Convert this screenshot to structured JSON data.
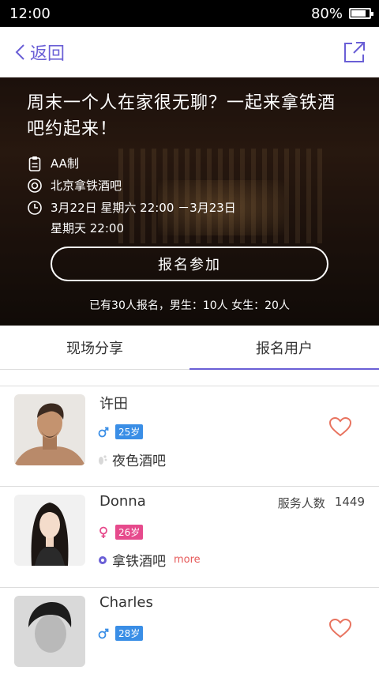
{
  "status_bar": {
    "time": "12:00",
    "battery": "80%",
    "battery_level": 0.8
  },
  "navbar": {
    "back_label": "返回"
  },
  "event": {
    "title": "周末一个人在家很无聊？一起来拿铁酒吧约起来！",
    "payment": "AA制",
    "location": "北京拿铁酒吧",
    "time_line1": "3月22日 星期六 22:00 －3月23日",
    "time_line2": "星期天 22:00",
    "signup_label": "报名参加",
    "signup_summary": "已有30人报名，男生：10人 女生：20人"
  },
  "tabs": [
    {
      "label": "现场分享",
      "active": false
    },
    {
      "label": "报名用户",
      "active": true
    }
  ],
  "users": [
    {
      "name": "许田",
      "gender": "male",
      "age": "25岁",
      "venue": "夜色酒吧",
      "venue_icon": "footprint-icon"
    },
    {
      "name": "Donna",
      "gender": "female",
      "age": "26岁",
      "venue": "拿铁酒吧",
      "venue_icon": "dot-icon",
      "more": "more",
      "service_label": "服务人数",
      "service_count": "1449"
    },
    {
      "name": "Charles",
      "gender": "male",
      "age": "28岁"
    }
  ],
  "colors": {
    "accent": "#6a5fd6",
    "male": "#3a8ee6",
    "female": "#e64a8c",
    "heart": "#e8735f"
  }
}
